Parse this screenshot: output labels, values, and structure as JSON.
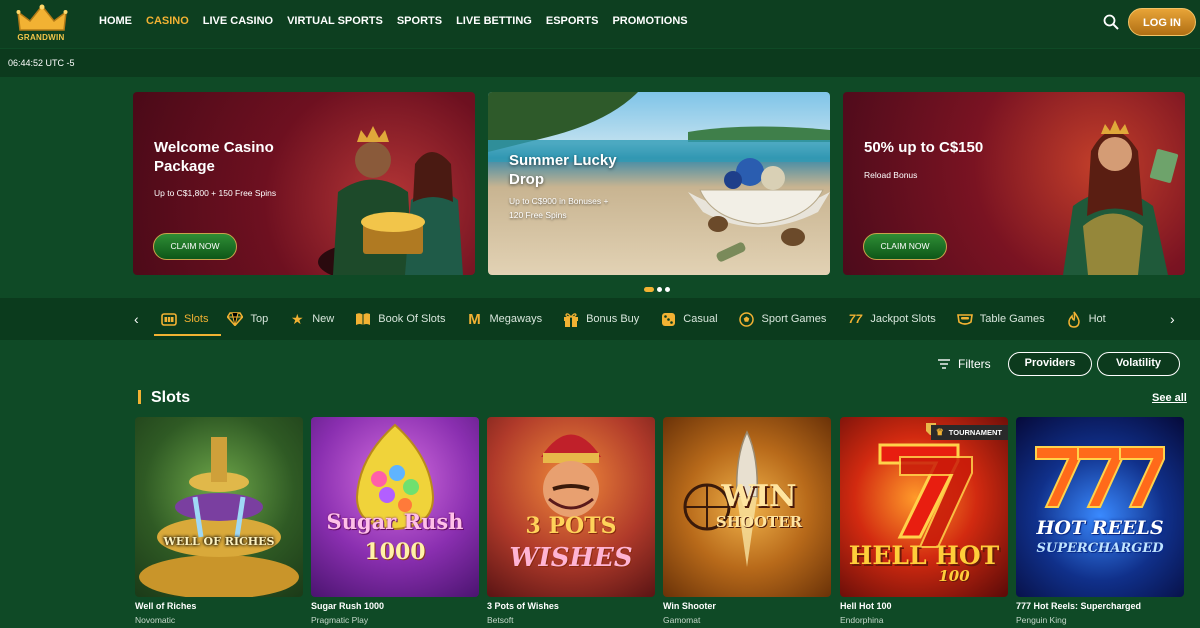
{
  "brand": {
    "logo_text": "GRANDWIN"
  },
  "nav": {
    "items": [
      {
        "label": "HOME",
        "active": false
      },
      {
        "label": "CASINO",
        "active": true
      },
      {
        "label": "LIVE CASINO",
        "active": false
      },
      {
        "label": "VIRTUAL SPORTS",
        "active": false
      },
      {
        "label": "SPORTS",
        "active": false
      },
      {
        "label": "LIVE BETTING",
        "active": false
      },
      {
        "label": "ESPORTS",
        "active": false
      },
      {
        "label": "PROMOTIONS",
        "active": false
      }
    ],
    "search_icon": "search-icon",
    "login_label": "LOG IN"
  },
  "clock": {
    "time": "06:44:52 UTC -5"
  },
  "promos": [
    {
      "title": "Welcome Casino Package",
      "subtitle": "Up to C$1,800 + 150 Free Spins",
      "button": "CLAIM NOW"
    },
    {
      "title": "Summer Lucky Drop",
      "subtitle": "Up to C$900 in Bonuses + 120 Free Spins"
    },
    {
      "title": "50% up to C$150",
      "subtitle": "Reload Bonus",
      "button": "CLAIM NOW"
    }
  ],
  "carousel": {
    "slides": 3,
    "active_index": 0
  },
  "categories": [
    {
      "label": "Slots",
      "icon": "slot-machine-icon",
      "active": true
    },
    {
      "label": "Top",
      "icon": "diamond-icon",
      "active": false
    },
    {
      "label": "New",
      "icon": "star-icon",
      "active": false
    },
    {
      "label": "Book Of Slots",
      "icon": "book-icon",
      "active": false
    },
    {
      "label": "Megaways",
      "icon": "megaways-icon",
      "active": false
    },
    {
      "label": "Bonus Buy",
      "icon": "gift-icon",
      "active": false
    },
    {
      "label": "Casual",
      "icon": "dice-icon",
      "active": false
    },
    {
      "label": "Sport Games",
      "icon": "soccer-ball-icon",
      "active": false
    },
    {
      "label": "Jackpot Slots",
      "icon": "jackpot-777-icon",
      "active": false
    },
    {
      "label": "Table Games",
      "icon": "table-icon",
      "active": false
    },
    {
      "label": "Hot",
      "icon": "flame-icon",
      "active": false
    }
  ],
  "filters": {
    "label": "Filters",
    "providers": "Providers",
    "volatility": "Volatility"
  },
  "section": {
    "title": "Slots",
    "see_all": "See all"
  },
  "games": [
    {
      "name": "Well of Riches",
      "provider": "Novomatic",
      "art_text": "WELL OF RICHES"
    },
    {
      "name": "Sugar Rush 1000",
      "provider": "Pragmatic Play",
      "art_text": "Sugar Rush",
      "art_text2": "1000"
    },
    {
      "name": "3 Pots of Wishes",
      "provider": "Betsoft",
      "art_text": "3 POTS",
      "art_text2": "WISHES"
    },
    {
      "name": "Win Shooter",
      "provider": "Gamomat",
      "art_text": "WIN",
      "art_text2": "SHOOTER"
    },
    {
      "name": "Hell Hot 100",
      "provider": "Endorphina",
      "art_text": "HELL HOT",
      "art_text2": "100",
      "badge": "TOURNAMENT"
    },
    {
      "name": "777 Hot Reels: Supercharged",
      "provider": "Penguin King",
      "art_text": "HOT REELS",
      "art_text2": "SUPERCHARGED"
    }
  ]
}
